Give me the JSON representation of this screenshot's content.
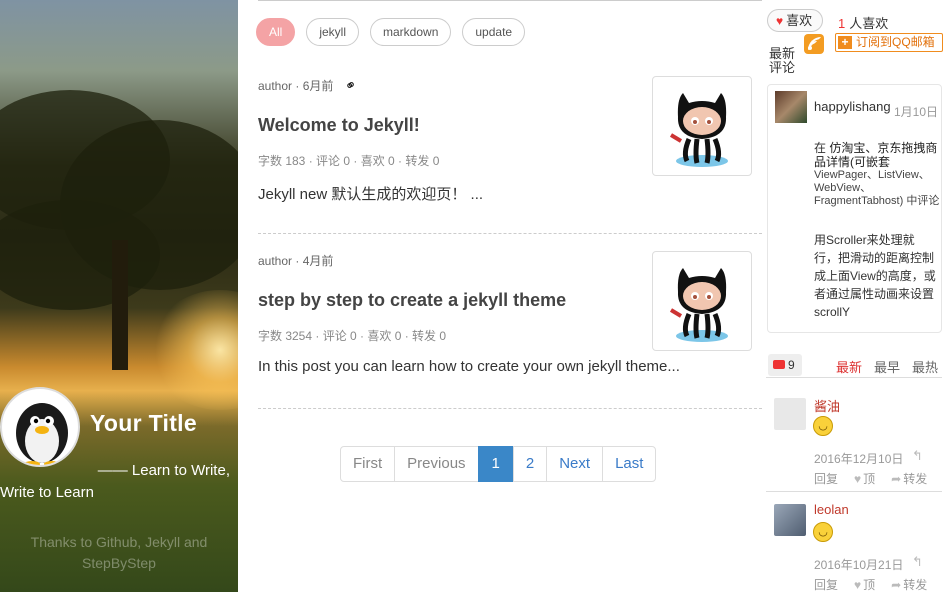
{
  "hero": {
    "title": "Your Title",
    "tagline_line1": "—— Learn to Write,",
    "tagline_line2": "Write to Learn",
    "thanks": "Thanks to Github, Jekyll and StepByStep"
  },
  "tags": [
    "All",
    "jekyll",
    "markdown",
    "update"
  ],
  "posts": [
    {
      "meta": "author · 6月前",
      "title": "Welcome to Jekyll!",
      "stats": "字数 183 · 评论 0 · 喜欢 0 · 转发 0",
      "excerpt": "Jekyll new 默认生成的欢迎页！ ..."
    },
    {
      "meta": "author · 4月前",
      "title": "step by step to create a jekyll theme",
      "stats": "字数 3254 · 评论 0 · 喜欢 0 · 转发 0",
      "excerpt": "In this post you can learn how to create your own jekyll theme..."
    }
  ],
  "pagination": [
    "First",
    "Previous",
    "1",
    "2",
    "Next",
    "Last"
  ],
  "sidebar": {
    "like_label": "喜欢",
    "like_count": "1",
    "like_suffix": "人喜欢",
    "latest_comments_label": "最新评论",
    "subscribe_label": "订阅到QQ邮箱",
    "recent_comment": {
      "user": "happylishang",
      "date": "1月10日",
      "on_prefix": "在",
      "on_title": "仿淘宝、京东拖拽商品详情(可嵌套",
      "on_suffix": "ViewPager、ListView、WebView、FragmentTabhost) 中评论",
      "body": "用Scroller来处理就行，把滑动的距离控制成上面View的高度，或者通过属性动画来设置scrollY"
    },
    "comment_count": "9",
    "comment_tabs": [
      "最新",
      "最早",
      "最热"
    ],
    "comments": [
      {
        "name": "酱油",
        "date": "2016年12月10日",
        "reply": "回复",
        "up": "顶",
        "share": "转发"
      },
      {
        "name": "leolan",
        "date": "2016年10月21日",
        "reply": "回复",
        "up": "顶",
        "share": "转发"
      }
    ]
  }
}
